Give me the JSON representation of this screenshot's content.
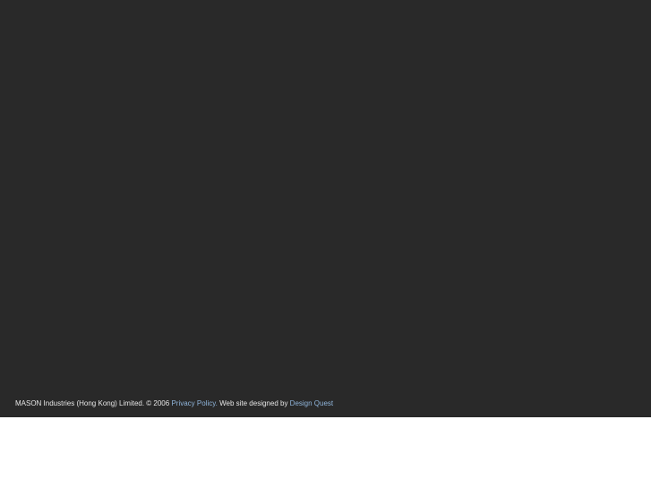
{
  "footer": {
    "copyright_text": "MASON Industries (Hong Kong) Limited. © 2006",
    "privacy_link": "Privacy Policy.",
    "designed_by_text": "Web site designed by",
    "designer_link": "Design Quest"
  },
  "colors": {
    "background_dark": "#292929",
    "footer_text": "#e6e6e6",
    "link_text": "#8fb4d9"
  }
}
